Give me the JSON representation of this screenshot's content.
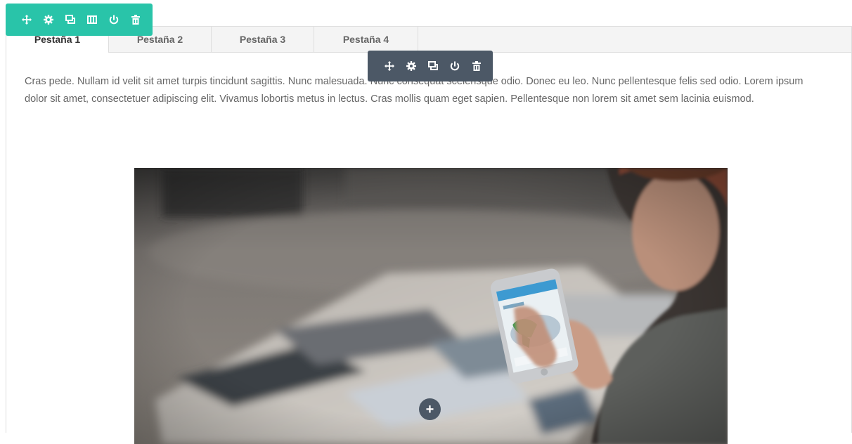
{
  "tabs": [
    {
      "label": "Pestaña 1",
      "active": true
    },
    {
      "label": "Pestaña 2",
      "active": false
    },
    {
      "label": "Pestaña 3",
      "active": false
    },
    {
      "label": "Pestaña 4",
      "active": false
    }
  ],
  "content": {
    "paragraph": "Cras pede. Nullam id velit sit amet turpis tincidunt sagittis. Nunc malesuada. Nunc consequat scelerisque odio. Donec eu leo. Nunc pellentesque felis sed odio. Lorem ipsum dolor sit amet, consectetuer adipiscing elit. Vivamus lobortis metus in lectus. Cras mollis quam eget sapien. Pellentesque non lorem sit amet sem lacinia euismod."
  },
  "row_toolbar": {
    "color": "#29c4a9",
    "icons": [
      "move-icon",
      "settings-icon",
      "duplicate-icon",
      "columns-icon",
      "save-icon",
      "delete-icon"
    ]
  },
  "module_toolbar": {
    "color": "#4c5866",
    "icons": [
      "move-icon",
      "settings-icon",
      "duplicate-icon",
      "save-icon",
      "delete-icon"
    ]
  },
  "add_button": {
    "label": "+"
  }
}
